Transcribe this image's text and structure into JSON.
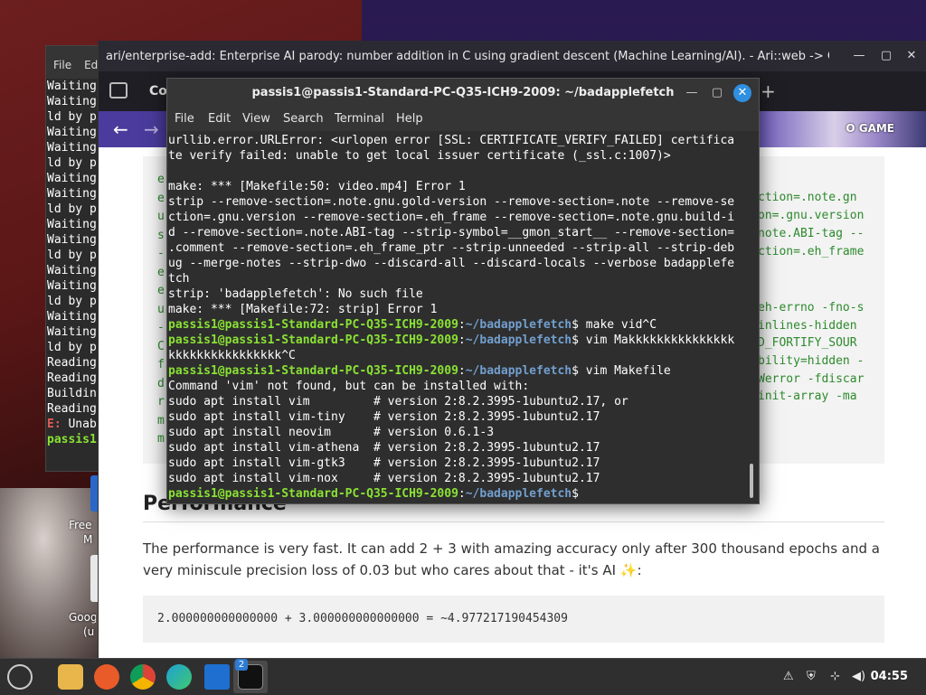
{
  "background_terminal": {
    "menu": [
      "File",
      "Ed"
    ],
    "lines": [
      "Waiting",
      "Waiting",
      "ld by p",
      "Waiting",
      "Waiting",
      "ld by p",
      "Waiting",
      "Waiting",
      "ld by p",
      "Waiting",
      "Waiting",
      "ld by p",
      "Waiting",
      "Waiting",
      "ld by p",
      "Waiting",
      "Waiting",
      "ld by p",
      "Reading",
      "Reading",
      "Buildin",
      "Reading"
    ],
    "error_prefix": "E:",
    "error_text": "Unab",
    "prompt": "passis1"
  },
  "desktop": {
    "labels": [
      "Free",
      "M",
      "Goog",
      "(u"
    ]
  },
  "browser": {
    "title": "ari/enterprise-add: Enterprise AI parody: number addition in C using gradient descent (Machine Learning/AI). - Ari::web -> Git: The...",
    "tab_label": "Col",
    "banner_text": "O GAME",
    "code_left": [
      "e",
      "e",
      "u",
      "s",
      "-",
      "e",
      "e",
      "u",
      "-",
      "C",
      "f",
      "d",
      "r",
      "m",
      "m"
    ],
    "code_right": [
      "ction=.note.gn",
      "on=.gnu.version",
      "note.ABI-tag --",
      "ction=.eh_frame",
      "",
      "",
      "eh-errno -fno-s",
      "inlines-hidden",
      "D_FORTIFY_SOUR",
      "bility=hidden -",
      "Werror -fdiscar",
      "init-array -ma"
    ],
    "section_heading": "Performance",
    "paragraph": "The performance is very fast. It can add 2 + 3 with amazing accuracy only after 300 thousand epochs and a very miniscule precision loss of 0.03 but who cares about that - it's AI ✨:",
    "result_code": "2.000000000000000 + 3.000000000000000 = ~4.977217190454309"
  },
  "terminal": {
    "title": "passis1@passis1-Standard-PC-Q35-ICH9-2009: ~/badapplefetch",
    "menu": [
      "File",
      "Edit",
      "View",
      "Search",
      "Terminal",
      "Help"
    ],
    "output_a": [
      "urllib.error.URLError: <urlopen error [SSL: CERTIFICATE_VERIFY_FAILED] certifica",
      "te verify failed: unable to get local issuer certificate (_ssl.c:1007)>",
      "",
      "make: *** [Makefile:50: video.mp4] Error 1",
      "strip --remove-section=.note.gnu.gold-version --remove-section=.note --remove-se",
      "ction=.gnu.version --remove-section=.eh_frame --remove-section=.note.gnu.build-i",
      "d --remove-section=.note.ABI-tag --strip-symbol=__gmon_start__ --remove-section=",
      ".comment --remove-section=.eh_frame_ptr --strip-unneeded --strip-all --strip-deb",
      "ug --merge-notes --strip-dwo --discard-all --discard-locals --verbose badapplefe",
      "tch",
      "strip: 'badapplefetch': No such file",
      "make: *** [Makefile:72: strip] Error 1"
    ],
    "prompt_user": "passis1@passis1-Standard-PC-Q35-ICH9-2009",
    "prompt_sep": ":",
    "prompt_path": "~/badapplefetch",
    "prompt_end": "$ ",
    "cmd1": "make vid^C",
    "cmd2": "vim Makkkkkkkkkkkkkkk",
    "cmd2_cont": "kkkkkkkkkkkkkkkk^C",
    "cmd3": "vim Makefile",
    "output_b": [
      "Command 'vim' not found, but can be installed with:",
      "sudo apt install vim         # version 2:8.2.3995-1ubuntu2.17, or",
      "sudo apt install vim-tiny    # version 2:8.2.3995-1ubuntu2.17",
      "sudo apt install neovim      # version 0.6.1-3",
      "sudo apt install vim-athena  # version 2:8.2.3995-1ubuntu2.17",
      "sudo apt install vim-gtk3    # version 2:8.2.3995-1ubuntu2.17",
      "sudo apt install vim-nox     # version 2:8.2.3995-1ubuntu2.17"
    ]
  },
  "taskbar": {
    "badge": "2",
    "clock": "04:55",
    "icons": [
      "mint-menu-icon",
      "files-icon",
      "firefox-icon",
      "chrome-icon",
      "edge-dev-icon",
      "remote-desktop-icon",
      "terminal-icon"
    ]
  },
  "colors": {
    "prompt_user": "#8ae234",
    "prompt_path": "#729fcf",
    "navbar": "#4a3b9c",
    "terminal_bg": "#2e2e2e"
  }
}
